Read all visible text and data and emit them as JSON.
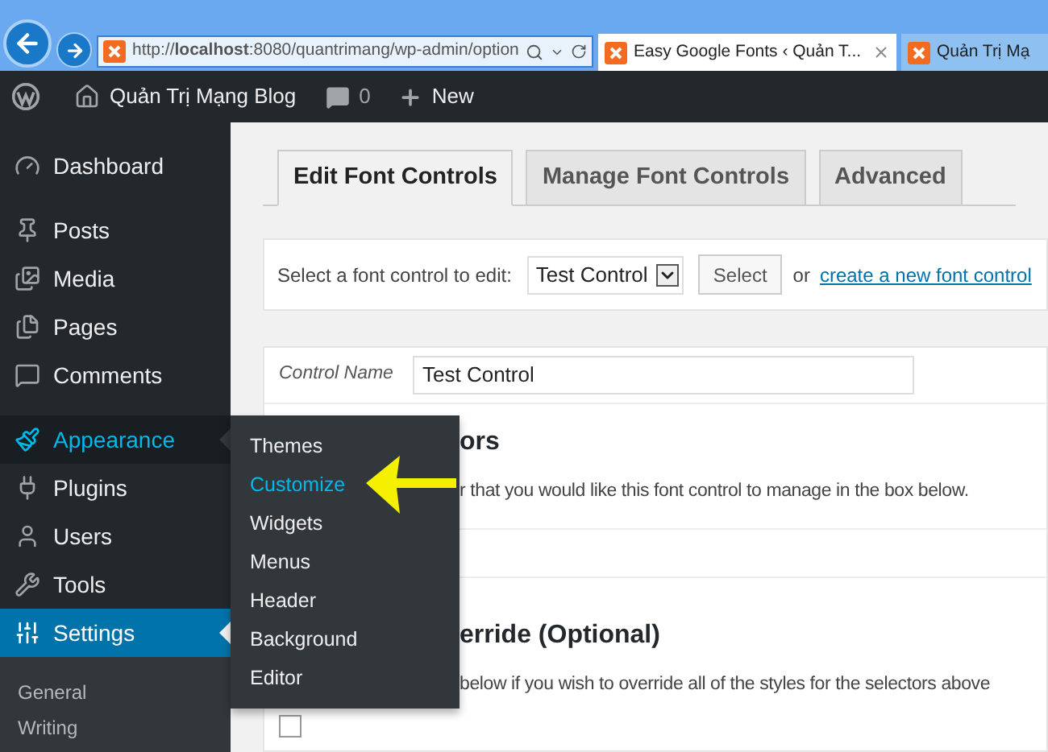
{
  "browser": {
    "address": {
      "value": "http://**localhost**:8080/quantrimang/wp-admin/option"
    },
    "tabs": [
      {
        "title": "Easy Google Fonts ‹ Quản T...",
        "selected": true
      },
      {
        "title": "Quản Trị Mạ",
        "selected": false
      }
    ]
  },
  "admin_bar": {
    "site": "Quản Trị Mạng Blog",
    "comments": "0",
    "new": "New"
  },
  "sidebar": {
    "groups": [
      [
        {
          "label": "Dashboard",
          "selected": false,
          "expanded": false
        }
      ],
      [
        {
          "label": "Posts",
          "selected": false,
          "expanded": false
        },
        {
          "label": "Media",
          "selected": false,
          "expanded": false
        },
        {
          "label": "Pages",
          "selected": false,
          "expanded": false
        },
        {
          "label": "Comments",
          "selected": false,
          "expanded": false
        }
      ],
      [
        {
          "label": "Appearance",
          "selected": false,
          "expanded": true,
          "children": [
            {
              "label": "Themes",
              "selected": false
            },
            {
              "label": "Customize",
              "selected": true
            },
            {
              "label": "Widgets",
              "selected": false
            },
            {
              "label": "Menus",
              "selected": false
            },
            {
              "label": "Header",
              "selected": false
            },
            {
              "label": "Background",
              "selected": false
            },
            {
              "label": "Editor",
              "selected": false
            }
          ]
        },
        {
          "label": "Plugins",
          "selected": false,
          "expanded": false
        },
        {
          "label": "Users",
          "selected": false,
          "expanded": false
        },
        {
          "label": "Tools",
          "selected": false,
          "expanded": false
        },
        {
          "label": "Settings",
          "selected": true,
          "expanded": false,
          "children": [
            {
              "label": "General",
              "selected": false
            },
            {
              "label": "Writing",
              "selected": false
            }
          ]
        }
      ]
    ]
  },
  "content": {
    "tabs": [
      {
        "label": "Edit Font Controls",
        "selected": true
      },
      {
        "label": "Manage Font Controls",
        "selected": false
      },
      {
        "label": "Advanced",
        "selected": false
      }
    ],
    "selector": {
      "label": "Select a font control to edit:",
      "value": "Test Control",
      "button": "Select",
      "or": "or",
      "link": "create a new font control"
    },
    "control_name": {
      "label": "Control Name",
      "value": "Test Control"
    },
    "sections": [
      {
        "heading": "ors",
        "description": "r that you would like this font control to manage in the box below."
      },
      {
        "heading": "erride (Optional)",
        "description": "below if you wish to override all of the styles for the selectors above",
        "checkbox": {
          "checked": false
        }
      }
    ]
  }
}
